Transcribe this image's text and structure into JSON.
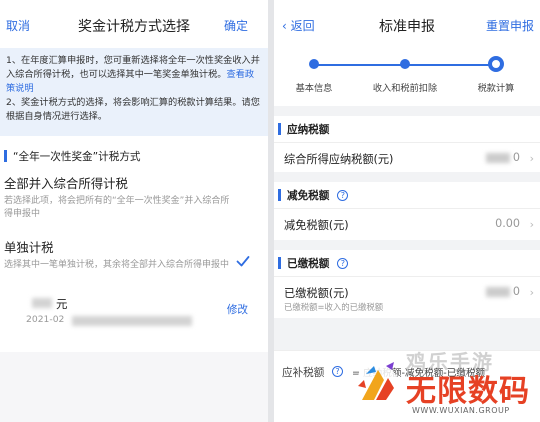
{
  "left": {
    "nav": {
      "cancel": "取消",
      "title": "奖金计税方式选择",
      "confirm": "确定"
    },
    "notice": {
      "text1": "1、在年度汇算申报时，您可重新选择将全年一次性奖金收入并入综合所得计税，也可以选择其中一笔奖金单独计税。",
      "link": "查看政策说明",
      "text2": "2、奖金计税方式的选择，将会影响汇算的税款计算结果。请您根据自身情况进行选择。"
    },
    "section_title": "“全年一次性奖金”计税方式",
    "options": [
      {
        "title": "全部并入综合所得计税",
        "desc": "若选择此项，将会把所有的“全年一次性奖金”并入综合所得申报中",
        "selected": false
      },
      {
        "title": "单独计税",
        "desc": "选择其中一笔单独计税，其余将全部并入综合所得申报中",
        "selected": true
      }
    ],
    "record": {
      "unit": "元",
      "date": "2021-02",
      "edit": "修改"
    }
  },
  "right": {
    "nav": {
      "back": "返回",
      "title": "标准申报",
      "redo": "重置申报"
    },
    "steps": [
      "基本信息",
      "收入和税前扣除",
      "税款计算"
    ],
    "current_step": 3,
    "sections": [
      {
        "title": "应纳税额",
        "help": false,
        "row": {
          "label": "综合所得应纳税额(元)",
          "value": "0",
          "sub": ""
        }
      },
      {
        "title": "减免税额",
        "help": true,
        "row": {
          "label": "减免税额(元)",
          "value": "0.00",
          "sub": ""
        }
      },
      {
        "title": "已缴税额",
        "help": true,
        "row": {
          "label": "已缴税额(元)",
          "value": "0",
          "sub": "已缴税额=收入的已缴税额"
        }
      }
    ],
    "footer": {
      "label": "应补税额",
      "help": "?",
      "formula": "= 应纳税额-减免税额-已缴税额"
    }
  },
  "watermark": {
    "brand": "无限数码",
    "ghost": "鸡乐手游",
    "url": "WWW.WUXIAN.GROUP"
  },
  "colors": {
    "accent": "#2f6de1",
    "notice_bg": "#eaf1fb",
    "brand": "#e64124"
  }
}
